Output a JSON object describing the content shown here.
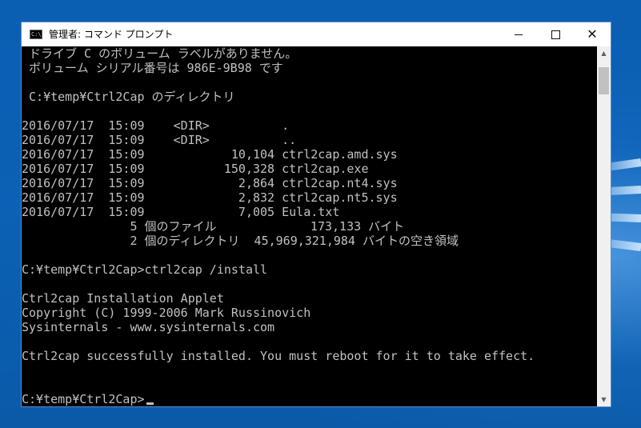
{
  "window": {
    "title": "管理者: コマンド プロンプト",
    "icon_label": "C:\\"
  },
  "controls": {
    "minimize_icon": "minimize-icon",
    "maximize_icon": "maximize-icon",
    "close_icon": "close-icon",
    "close_glyph": "✕"
  },
  "scrollbar": {
    "up_glyph": "▲",
    "down_glyph": "▼"
  },
  "console": {
    "lines": [
      " ドライブ C のボリューム ラベルがありません。",
      " ボリューム シリアル番号は 986E-9B98 です",
      "",
      " C:¥temp¥Ctrl2Cap のディレクトリ",
      "",
      "2016/07/17  15:09    <DIR>          .",
      "2016/07/17  15:09    <DIR>          ..",
      "2016/07/17  15:09            10,104 ctrl2cap.amd.sys",
      "2016/07/17  15:09           150,328 ctrl2cap.exe",
      "2016/07/17  15:09             2,864 ctrl2cap.nt4.sys",
      "2016/07/17  15:09             2,832 ctrl2cap.nt5.sys",
      "2016/07/17  15:09             7,005 Eula.txt",
      "               5 個のファイル             173,133 バイト",
      "               2 個のディレクトリ  45,969,321,984 バイトの空き領域",
      "",
      "C:¥temp¥Ctrl2Cap>ctrl2cap /install",
      "",
      "Ctrl2cap Installation Applet",
      "Copyright (C) 1999-2006 Mark Russinovich",
      "Sysinternals - www.sysinternals.com",
      "",
      "Ctrl2cap successfully installed. You must reboot for it to take effect.",
      "",
      "",
      "C:¥temp¥Ctrl2Cap>"
    ]
  },
  "colors": {
    "console_background": "#000000",
    "console_text": "#c0c0c0",
    "titlebar_background": "#ffffff",
    "desktop_background": "#0b5cad"
  }
}
